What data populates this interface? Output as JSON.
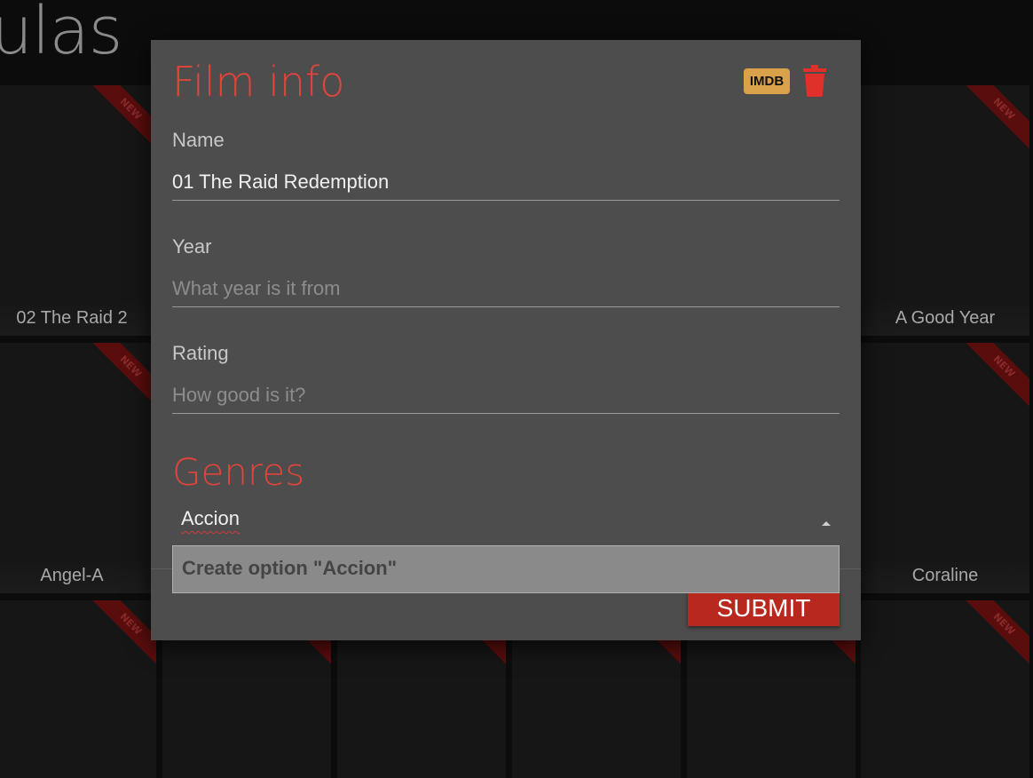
{
  "background": {
    "page_title_fragment": "ulas",
    "ribbon_label": "NEW",
    "tiles": [
      {
        "label": ""
      },
      {
        "label": "02 The Raid 2"
      },
      {
        "label": "A Good Year"
      },
      {
        "label": "Angel-A"
      },
      {
        "label": "Coraline"
      },
      {
        "label": ""
      }
    ]
  },
  "modal": {
    "title": "Film info",
    "imdb_label": "IMDB",
    "fields": {
      "name": {
        "label": "Name",
        "value": "01 The Raid Redemption",
        "placeholder": ""
      },
      "year": {
        "label": "Year",
        "value": "",
        "placeholder": "What year is it from"
      },
      "rating": {
        "label": "Rating",
        "value": "",
        "placeholder": "How good is it?"
      }
    },
    "genres": {
      "title": "Genres",
      "input_value": "Accion",
      "dropdown_option": "Create option \"Accion\""
    },
    "submit_label": "SUBMIT"
  },
  "colors": {
    "accent": "#e0443a",
    "modal_bg": "#4d4d4d",
    "imdb": "#d9a24a",
    "submit": "#b8281f"
  },
  "icons": [
    "trash-icon",
    "chevron-up-icon"
  ]
}
